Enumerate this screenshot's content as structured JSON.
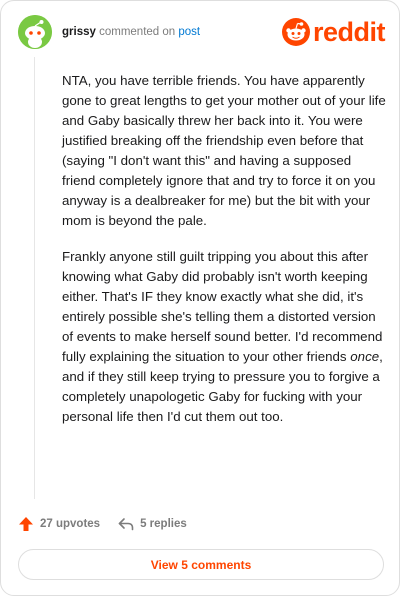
{
  "header": {
    "username": "grissy",
    "action_text": "commented on",
    "link_text": "post",
    "logo_text": "reddit"
  },
  "comment": {
    "paragraph1": "NTA, you have terrible friends. You have apparently gone to great lengths to get your mother out of your life and Gaby basically threw her back into it. You were justified breaking off the friendship even before that (saying \"I don't want this\" and having a supposed friend completely ignore that and try to force it on you anyway is a dealbreaker for me) but the bit with your mom is beyond the pale.",
    "paragraph2_a": "Frankly anyone still guilt tripping you about this after knowing what Gaby did probably isn't worth keeping either. That's IF they know exactly what she did, it's entirely possible she's telling them a distorted version of events to make herself sound better. I'd recommend fully explaining the situation to your other friends ",
    "paragraph2_em": "once",
    "paragraph2_b": ", and if they still keep trying to pressure you to forgive a completely unapologetic Gaby for fucking with your personal life then I'd cut them out too."
  },
  "actions": {
    "upvotes": "27 upvotes",
    "replies": "5 replies"
  },
  "view_button": "View 5 comments",
  "colors": {
    "accent": "#ff4500",
    "link": "#0079d3",
    "avatar_bg": "#7ac943"
  },
  "icons": {
    "avatar": "snoo-avatar-icon",
    "logo": "reddit-snoo-icon",
    "upvote": "upvote-arrow-icon",
    "reply": "reply-arrow-icon"
  }
}
